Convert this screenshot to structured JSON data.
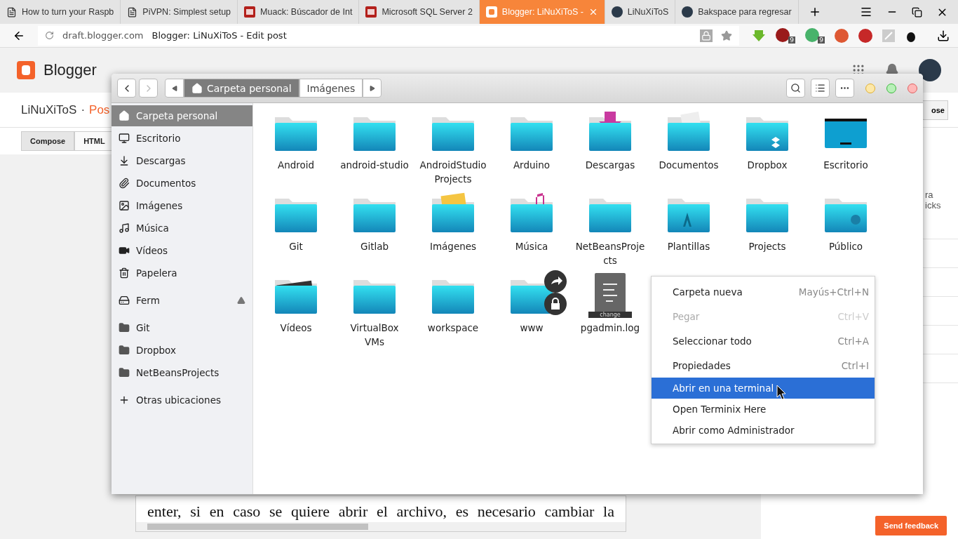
{
  "browser": {
    "tabs": [
      {
        "title": "How to turn your Raspb",
        "kind": "page",
        "selected": false
      },
      {
        "title": "PiVPN: Simplest setup",
        "kind": "page",
        "selected": false
      },
      {
        "title": "Muack: Búscador de Int",
        "kind": "jv",
        "selected": false
      },
      {
        "title": "Microsoft SQL Server 2",
        "kind": "jv",
        "selected": false
      },
      {
        "title": "Blogger: LiNuXiToS -",
        "kind": "blogger",
        "selected": true
      },
      {
        "title": "LiNuXiToS",
        "kind": "avatar",
        "selected": false
      },
      {
        "title": "Bakspace para regresar",
        "kind": "avatar",
        "selected": false
      }
    ],
    "address": {
      "host": "draft.blogger.com",
      "title": "Blogger: LiNuXiToS - Edit post"
    },
    "extension_badges": [
      "9",
      "9"
    ]
  },
  "blogger": {
    "brand": "Blogger",
    "blog": "LiNuXiToS",
    "separator": "·",
    "crumb": "Pos",
    "modes": [
      {
        "label": "Compose",
        "selected": true
      },
      {
        "label": "HTML",
        "selected": false
      }
    ],
    "right_button": "ose",
    "side_fragments": [
      "ra",
      "icks"
    ],
    "editor_lines": [
      "enter, si en caso se quiere abrir el archivo, es necesario cambiar la"
    ],
    "feedback": "Send feedback"
  },
  "file_manager": {
    "forward_disabled": true,
    "path": [
      {
        "label": "Carpeta personal",
        "selected": true
      },
      {
        "label": "Imágenes",
        "selected": false
      }
    ],
    "sidebar": [
      {
        "label": "Carpeta personal",
        "kind": "home",
        "selected": true
      },
      {
        "label": "Escritorio",
        "kind": "desktop",
        "selected": false
      },
      {
        "label": "Descargas",
        "kind": "download",
        "selected": false
      },
      {
        "label": "Documentos",
        "kind": "clip",
        "selected": false
      },
      {
        "label": "Imágenes",
        "kind": "image",
        "selected": false
      },
      {
        "label": "Música",
        "kind": "music",
        "selected": false
      },
      {
        "label": "Vídeos",
        "kind": "video",
        "selected": false
      },
      {
        "label": "Papelera",
        "kind": "trash",
        "selected": false
      },
      {
        "label": "Ferm",
        "kind": "drive",
        "selected": false,
        "eject": true
      },
      {
        "label": "Git",
        "kind": "folder",
        "selected": false
      },
      {
        "label": "Dropbox",
        "kind": "folder",
        "selected": false
      },
      {
        "label": "NetBeansProjects",
        "kind": "folder",
        "selected": false
      },
      {
        "label": "Otras ubicaciones",
        "kind": "plus",
        "selected": false
      }
    ],
    "files": [
      {
        "name": "Android",
        "kind": "folder"
      },
      {
        "name": "android-studio",
        "kind": "folder"
      },
      {
        "name": "AndroidStudio Projects",
        "kind": "folder"
      },
      {
        "name": "Arduino",
        "kind": "folder"
      },
      {
        "name": "Descargas",
        "kind": "downloads"
      },
      {
        "name": "Documentos",
        "kind": "documents"
      },
      {
        "name": "Dropbox",
        "kind": "dropbox"
      },
      {
        "name": "Escritorio",
        "kind": "desktop"
      },
      {
        "name": "Git",
        "kind": "folder"
      },
      {
        "name": "Gitlab",
        "kind": "folder"
      },
      {
        "name": "Imágenes",
        "kind": "images"
      },
      {
        "name": "Música",
        "kind": "music"
      },
      {
        "name": "NetBeansProje cts",
        "kind": "folder"
      },
      {
        "name": "Plantillas",
        "kind": "templates"
      },
      {
        "name": "Projects",
        "kind": "folder"
      },
      {
        "name": "Público",
        "kind": "public"
      },
      {
        "name": "Vídeos",
        "kind": "videos"
      },
      {
        "name": "VirtualBox VMs",
        "kind": "folder"
      },
      {
        "name": "workspace",
        "kind": "folder"
      },
      {
        "name": "www",
        "kind": "linked"
      },
      {
        "name": "pgadmin.log",
        "kind": "textfile",
        "icon_label": "change"
      }
    ],
    "context_menu": [
      {
        "label": "Carpeta nueva",
        "shortcut": "Mayús+Ctrl+N",
        "disabled": false,
        "selected": false
      },
      {
        "label": "Pegar",
        "shortcut": "Ctrl+V",
        "disabled": true,
        "selected": false
      },
      {
        "label": "Seleccionar todo",
        "shortcut": "Ctrl+A",
        "disabled": false,
        "selected": false
      },
      {
        "label": "Propiedades",
        "shortcut": "Ctrl+I",
        "disabled": false,
        "selected": false
      },
      {
        "label": "Abrir en una terminal",
        "disabled": false,
        "selected": true
      },
      {
        "label": "Open Terminix Here",
        "disabled": false,
        "selected": false
      },
      {
        "label": "Abrir como Administrador",
        "disabled": false,
        "selected": false
      }
    ]
  }
}
